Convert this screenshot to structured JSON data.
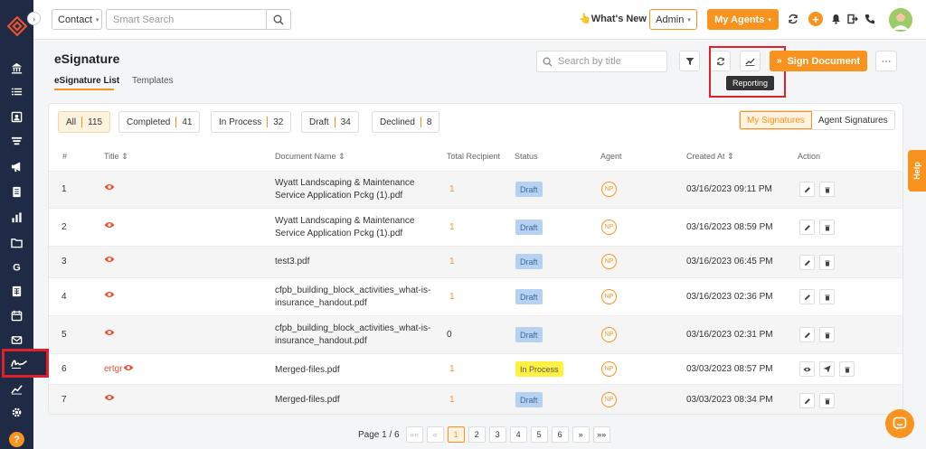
{
  "topbar": {
    "contact_select": "Contact",
    "smart_search_placeholder": "Smart Search",
    "whats_new": "👆What's New",
    "admin_select": "Admin",
    "my_agents": "My Agents"
  },
  "page": {
    "title": "eSignature",
    "tabs": [
      "eSignature List",
      "Templates"
    ],
    "search_placeholder": "Search by title",
    "tooltip": "Reporting",
    "sign_document": "Sign Document",
    "more": "···"
  },
  "filters": [
    {
      "label": "All",
      "count": "115"
    },
    {
      "label": "Completed",
      "count": "41"
    },
    {
      "label": "In Process",
      "count": "32"
    },
    {
      "label": "Draft",
      "count": "34"
    },
    {
      "label": "Declined",
      "count": "8"
    }
  ],
  "segment": [
    "My Signatures",
    "Agent Signatures"
  ],
  "columns": [
    "#",
    "Title ⇕",
    "Document Name ⇕",
    "Total Recipient",
    "Status",
    "Agent",
    "Created At ⇕",
    "Action"
  ],
  "rows": [
    {
      "num": "1",
      "title": "",
      "doc": "Wyatt Landscaping & Maintenance Service Application Pckg (1).pdf",
      "recipients": "1",
      "status": "Draft",
      "agent": "NP",
      "created": "03/16/2023 09:11 PM"
    },
    {
      "num": "2",
      "title": "",
      "doc": "Wyatt Landscaping & Maintenance Service Application Pckg (1).pdf",
      "recipients": "1",
      "status": "Draft",
      "agent": "NP",
      "created": "03/16/2023 08:59 PM"
    },
    {
      "num": "3",
      "title": "",
      "doc": "test3.pdf",
      "recipients": "1",
      "status": "Draft",
      "agent": "NP",
      "created": "03/16/2023 06:45 PM"
    },
    {
      "num": "4",
      "title": "",
      "doc": "cfpb_building_block_activities_what-is-insurance_handout.pdf",
      "recipients": "1",
      "status": "Draft",
      "agent": "NP",
      "created": "03/16/2023 02:36 PM"
    },
    {
      "num": "5",
      "title": "",
      "doc": "cfpb_building_block_activities_what-is-insurance_handout.pdf",
      "recipients": "0",
      "status": "Draft",
      "agent": "NP",
      "created": "03/16/2023 02:31 PM"
    },
    {
      "num": "6",
      "title": "ertgr",
      "doc": "Merged-files.pdf",
      "recipients": "1",
      "status": "In Process",
      "agent": "NP",
      "created": "03/03/2023 08:57 PM"
    },
    {
      "num": "7",
      "title": "",
      "doc": "Merged-files.pdf",
      "recipients": "1",
      "status": "Draft",
      "agent": "NP",
      "created": "03/03/2023 08:34 PM"
    }
  ],
  "pager": {
    "label": "Page 1 / 6",
    "first": "««",
    "prev": "«",
    "pages": [
      "1",
      "2",
      "3",
      "4",
      "5",
      "6"
    ],
    "next": "»",
    "last": "»»"
  },
  "help_tab": "Help",
  "sidebar_help": "?",
  "colors": {
    "accent": "#f7931e",
    "sidebar": "#1f2a44",
    "highlight": "#e0202a"
  }
}
